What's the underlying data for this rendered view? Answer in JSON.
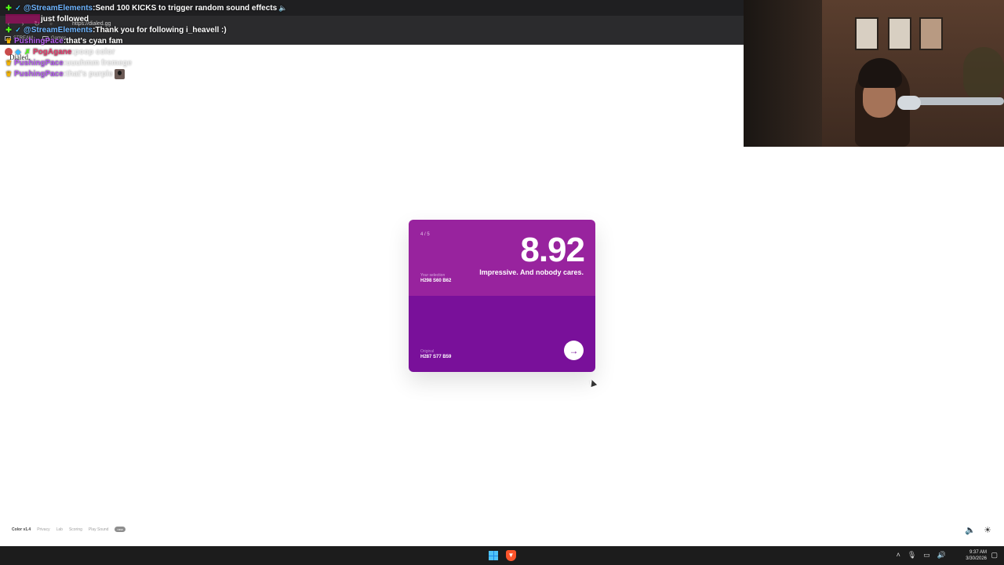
{
  "browser": {
    "url": "https://dialed.gg",
    "bookmarks": [
      "STREAM",
      "Games"
    ]
  },
  "chat": {
    "lines": [
      {
        "user": "@StreamElements",
        "sep": ": ",
        "message": "Send 100 KICKS to trigger random sound effects"
      },
      {
        "user": "",
        "sep": "",
        "message": "just followed"
      },
      {
        "user": "@StreamElements",
        "sep": ": ",
        "message": "Thank you for following i_heavell :)"
      },
      {
        "user": "PushingPace",
        "sep": ": ",
        "message": "that's cyan fam"
      },
      {
        "user": "PogAgane",
        "sep": ": ",
        "message": "poop color"
      },
      {
        "user": "PushingPace",
        "sep": ": ",
        "message": "uuuhmm fremege"
      },
      {
        "user": "PushingPace",
        "sep": ": ",
        "message": "that's purple"
      }
    ]
  },
  "site": {
    "logo": "Dialed."
  },
  "card": {
    "round": "4 / 5",
    "score": "8.92",
    "tagline": "Impressive. And nobody cares.",
    "selection_label": "Your selection",
    "selection_value": "H298 S60 B62",
    "original_label": "Original",
    "original_value": "H287 S77 B59",
    "next_icon": "arrow-right-icon",
    "colors": {
      "selection": "#98239e",
      "original": "#79109a"
    }
  },
  "footer": {
    "brand": "Color v1.4",
    "links": [
      "Privacy",
      "Lab",
      "Scoring",
      "Play Sound"
    ],
    "pill": "new",
    "icons": [
      "volume-icon",
      "theme-toggle-icon"
    ]
  },
  "taskbar": {
    "time": "9:37 AM",
    "date": "3/30/2026"
  }
}
